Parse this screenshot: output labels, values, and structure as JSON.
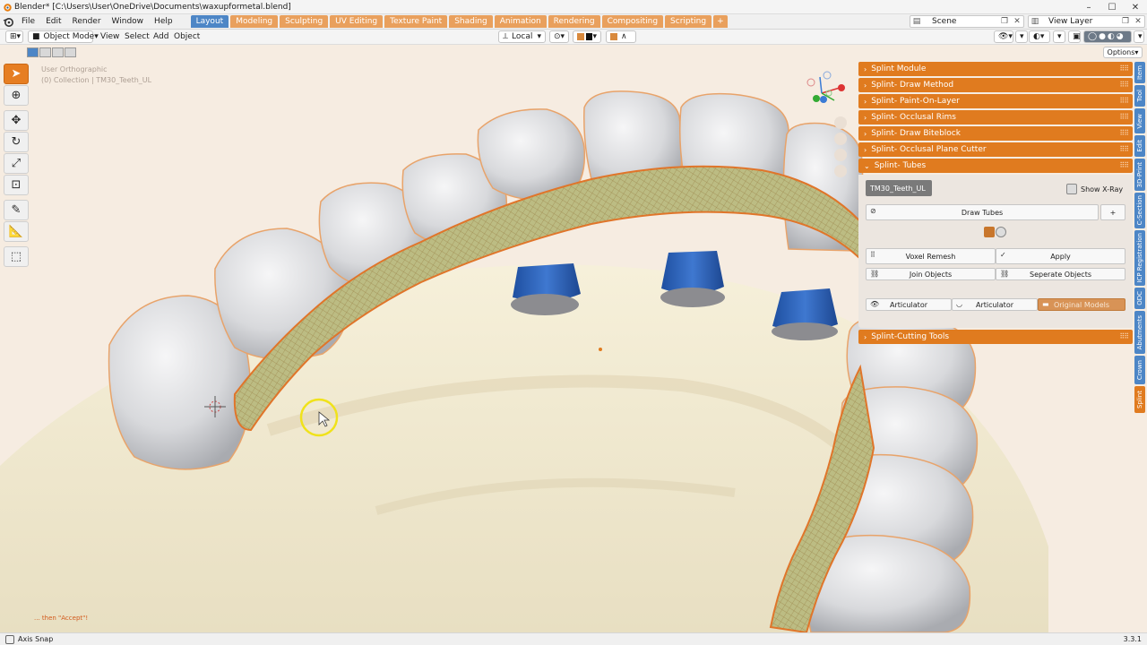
{
  "window": {
    "title": "Blender* [C:\\Users\\User\\OneDrive\\Documents\\waxupformetal.blend]",
    "controls": [
      "minimize",
      "maximize",
      "close"
    ]
  },
  "menubar": {
    "items": [
      "File",
      "Edit",
      "Render",
      "Window",
      "Help"
    ],
    "workspaces": [
      {
        "label": "Layout",
        "active": true
      },
      {
        "label": "Modeling"
      },
      {
        "label": "Sculpting"
      },
      {
        "label": "UV Editing"
      },
      {
        "label": "Texture Paint"
      },
      {
        "label": "Shading"
      },
      {
        "label": "Animation"
      },
      {
        "label": "Rendering"
      },
      {
        "label": "Compositing"
      },
      {
        "label": "Scripting"
      }
    ],
    "add_workspace": "+",
    "scene": "Scene",
    "view_layer": "View Layer"
  },
  "viewport_header": {
    "mode": "Object Mode",
    "menus": [
      "View",
      "Select",
      "Add",
      "Object"
    ],
    "orientation": "Local",
    "options": "Options"
  },
  "viewport": {
    "view_name": "User Orthographic",
    "collection": "(0) Collection | TM30_Teeth_UL",
    "hint": "... then \"Accept\"!"
  },
  "sidebar": {
    "panels": [
      {
        "label": "Splint Module",
        "collapsed": true
      },
      {
        "label": "Splint- Draw Method",
        "collapsed": true
      },
      {
        "label": "Splint- Paint-On-Layer",
        "collapsed": true
      },
      {
        "label": "Splint- Occlusal Rims",
        "collapsed": true
      },
      {
        "label": "Splint- Draw Biteblock",
        "collapsed": true
      },
      {
        "label": "Splint- Occlusal Plane Cutter",
        "collapsed": true
      },
      {
        "label": "Splint- Tubes",
        "collapsed": false
      }
    ],
    "tubes": {
      "object": "TM30_Teeth_UL",
      "show_xray": "Show X-Ray",
      "draw_tubes": "Draw Tubes",
      "add": "+",
      "voxel_remesh": "Voxel Remesh",
      "apply": "Apply",
      "join_objects": "Join Objects",
      "seperate_objects": "Seperate Objects",
      "articulator_1": "Articulator",
      "articulator_2": "Articulator",
      "original_models": "Original Models",
      "swatch_color": "#c8762c"
    },
    "cutting_tools": "Splint-Cutting Tools",
    "tabs": [
      "Item",
      "Tool",
      "View",
      "Edit",
      "3D-Print",
      "C-Section",
      "ICP Registration",
      "ODC",
      "Abutments",
      "Crown",
      "Splint"
    ],
    "active_tab": "Splint"
  },
  "statusbar": {
    "left": "Axis Snap",
    "version": "3.3.1"
  },
  "colors": {
    "accent_orange": "#e07b1f",
    "tab_blue": "#4d86c6",
    "mesh_green": "#b7b87a",
    "model_base": "#f2ead2"
  }
}
